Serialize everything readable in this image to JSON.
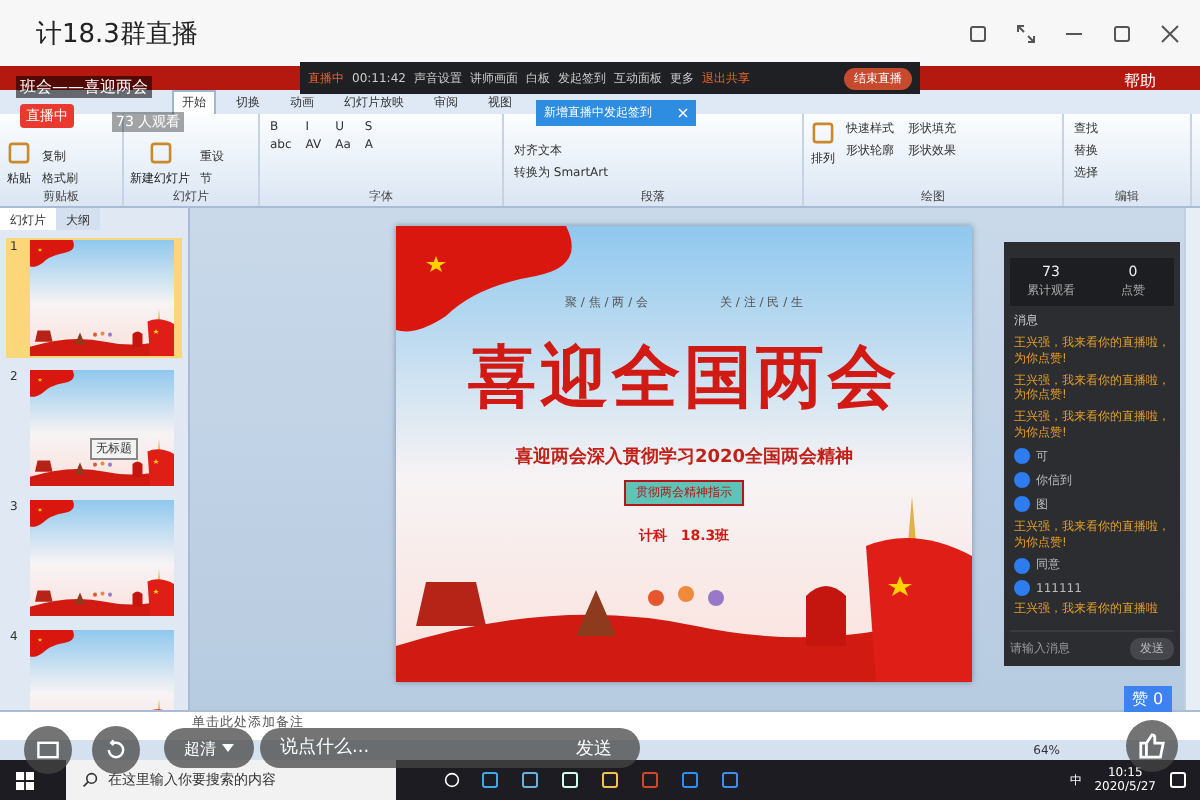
{
  "window": {
    "title": "计18.3群直播"
  },
  "live_toolbar": {
    "status": "直播中",
    "timer": "00:11:42",
    "items": [
      "声音设置",
      "讲师画面",
      "白板",
      "发起签到",
      "互动面板",
      "更多"
    ],
    "exit": "退出共享",
    "end": "结束直播"
  },
  "popup": {
    "text": "新增直播中发起签到"
  },
  "ribbon": {
    "help": "帮助",
    "tabs": [
      {
        "label": "开始",
        "selected": true
      },
      {
        "label": "切换",
        "selected": false
      },
      {
        "label": "动画",
        "selected": false
      },
      {
        "label": "幻灯片放映",
        "selected": false
      },
      {
        "label": "审阅",
        "selected": false
      },
      {
        "label": "视图",
        "selected": false
      }
    ],
    "groups": [
      {
        "label": "剪贴板",
        "big": "粘贴",
        "small": [
          "复制",
          "格式刷"
        ]
      },
      {
        "label": "幻灯片",
        "big": "新建幻灯片",
        "small": [
          "重设",
          "节"
        ]
      },
      {
        "label": "字体",
        "small": [
          "B",
          "I",
          "U",
          "S",
          "abc",
          "AV",
          "Aa",
          "A"
        ]
      },
      {
        "label": "段落",
        "small": [
          "对齐文本",
          "转换为 SmartArt"
        ]
      },
      {
        "label": "绘图",
        "big": "排列",
        "small": [
          "快速样式",
          "形状填充",
          "形状轮廓",
          "形状效果"
        ]
      },
      {
        "label": "编辑",
        "small": [
          "查找",
          "替换",
          "选择"
        ]
      }
    ]
  },
  "pane": {
    "tabs": [
      {
        "label": "幻灯片",
        "selected": true
      },
      {
        "label": "大纲",
        "selected": false
      }
    ],
    "thumbnails": [
      {
        "number": "1",
        "selected": true
      },
      {
        "number": "2",
        "selected": false,
        "tooltip": "无标题"
      },
      {
        "number": "3",
        "selected": false
      },
      {
        "number": "4",
        "selected": false
      }
    ]
  },
  "slide": {
    "header_left": "聚 / 焦 / 两 / 会",
    "header_right": "关 / 注 / 民 / 生",
    "title": "喜迎全国两会",
    "subtitle": "喜迎两会深入贯彻学习2020全国两会精神",
    "badge": "贯彻两会精神指示",
    "class": "计科　18.3班"
  },
  "chat": {
    "stats": [
      {
        "value": "73",
        "label": "累计观看"
      },
      {
        "value": "0",
        "label": "点赞"
      }
    ],
    "heading": "消息",
    "messages": [
      {
        "kind": "notice",
        "text": "王兴强，我来看你的直播啦，为你点赞!"
      },
      {
        "kind": "notice",
        "text": "王兴强，我来看你的直播啦，为你点赞!"
      },
      {
        "kind": "notice",
        "text": "王兴强，我来看你的直播啦，为你点赞!"
      },
      {
        "kind": "user",
        "text": "可"
      },
      {
        "kind": "user",
        "text": "你信到"
      },
      {
        "kind": "user",
        "text": "图"
      },
      {
        "kind": "notice",
        "text": "王兴强，我来看你的直播啦，为你点赞!"
      },
      {
        "kind": "user",
        "text": "同意"
      },
      {
        "kind": "user",
        "text": "111111"
      },
      {
        "kind": "notice",
        "text": "王兴强，我来看你的直播啦"
      }
    ],
    "placeholder": "请输入消息",
    "send": "发送"
  },
  "notes": {
    "placeholder": "单击此处添加备注"
  },
  "status_bar": {
    "zoom": "64%"
  },
  "overlay": {
    "live_badge": "直播中",
    "topic": "班会——喜迎两会",
    "viewers": "73 人观看",
    "quality": "超清",
    "comment_placeholder": "说点什么...",
    "send": "发送",
    "likes": "赞 0"
  },
  "taskbar": {
    "search_placeholder": "在这里输入你要搜索的内容",
    "ime": "中",
    "time": "10:15",
    "date": "2020/5/27"
  }
}
